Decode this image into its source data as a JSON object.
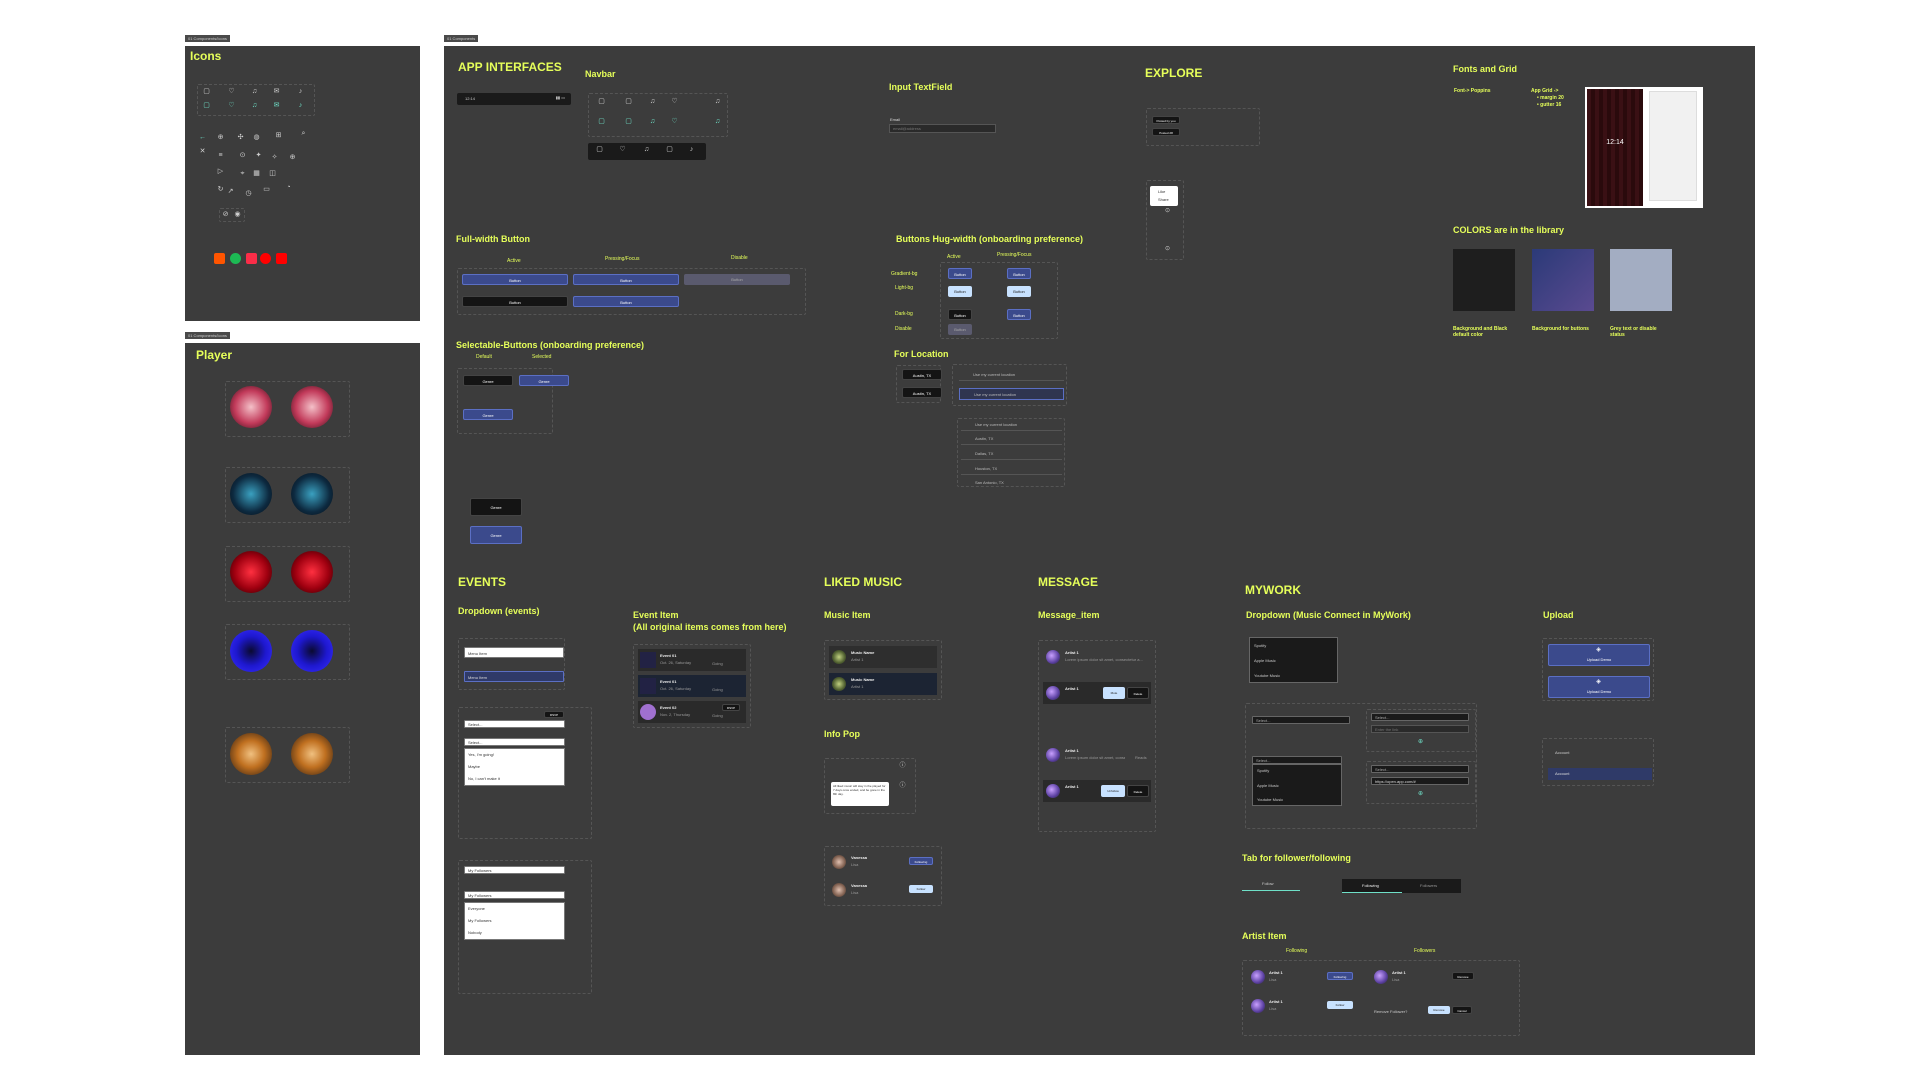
{
  "frame_tags": {
    "icons": "01 Components/Icons",
    "player": "01 Components/Icons",
    "main": "01 Components"
  },
  "icons_title": "Icons",
  "player_title": "Player",
  "app_interfaces": {
    "title": "APP INTERFACES",
    "status_time": "12:14",
    "navbar_title": "Navbar",
    "input_title": "Input TextField",
    "input_label": "Email",
    "input_placeholder": "email@address",
    "full_width_title": "Full-width Button",
    "states": [
      "Active",
      "Pressing/Focus",
      "Disable"
    ],
    "button_label": "Button",
    "selectable_title": "Selectable-Buttons (onboarding preference)",
    "selectable_states": [
      "Default",
      "Selected"
    ],
    "genre_label": "Genre",
    "hug_title": "Buttons Hug-width (onboarding preference)",
    "hug_states": [
      "Active",
      "Pressing/Focus"
    ],
    "hug_rows": [
      "Gradient-bg",
      "Light-bg",
      "Dark-bg",
      "Disable"
    ],
    "location_title": "For Location",
    "location_chip": "Austin, TX",
    "use_current": "Use my current location",
    "locations": [
      "Use my current location",
      "Austin, TX",
      "Dallas, TX",
      "Houston, TX",
      "San Antonio, TX"
    ]
  },
  "explore": {
    "title": "EXPLORE",
    "chips": [
      "Posted by you",
      "Posted 28"
    ],
    "menu": [
      "Like",
      "Share"
    ]
  },
  "fonts": {
    "title": "Fonts and Grid",
    "font_line": "Font-> Poppins",
    "grid_line1": "App Grid ->",
    "grid_line2": "• margin 20",
    "grid_line3": "• gutter 16",
    "clock": "12:14"
  },
  "colors": {
    "title": "COLORS are in the library",
    "swatches": [
      {
        "color": "#1e1e1e",
        "label": "Background and Black default color"
      },
      {
        "color": "#3f4f8a",
        "label": "Background for buttons"
      },
      {
        "color": "#a3adc2",
        "label": "Grey text or disable status"
      }
    ]
  },
  "events": {
    "title": "EVENTS",
    "dropdown_title": "Dropdown (events)",
    "menu_item": "Menu Item",
    "rsvp": "RSVP",
    "select": "Select...",
    "options": [
      "Yes, I'm going!",
      "Maybe",
      "No, I can't make it"
    ],
    "followers_select": "My Followers",
    "followers_options": [
      "Everyone",
      "My Followers",
      "Nobody"
    ],
    "event_item_title": "Event Item",
    "event_item_sub": "(All original items comes from here)",
    "event_items": [
      {
        "name": "Event 01",
        "date": "Oct. 26, Saturday"
      },
      {
        "name": "Event 01",
        "date": "Oct. 26, Saturday"
      },
      {
        "name": "Event 02",
        "date": "Nov. 2, Thursday"
      }
    ],
    "going": "Going"
  },
  "liked": {
    "title": "LIKED MUSIC",
    "music_item_title": "Music Item",
    "items": [
      {
        "name": "Music Name",
        "artist": "Artist 1"
      },
      {
        "name": "Music Name",
        "artist": "Artist 1"
      }
    ],
    "info_pop_title": "Info Pop",
    "info_pop_text": "All liked music will stay in the played for 7 days once ended, and be gone in the 8th day.",
    "follow_people": [
      {
        "name": "Vanessa",
        "sub": "Lisa",
        "action": "Following"
      },
      {
        "name": "Vanessa",
        "sub": "Lisa",
        "action": "Follow"
      }
    ]
  },
  "message": {
    "title": "MESSAGE",
    "item_title": "Message_item",
    "artist": "Artist 1",
    "preview": "Lorem ipsum dolor sit amet, consectetur a...",
    "mute": "Mute",
    "delete": "Delete",
    "unfollow": "Unfollow",
    "time": "Reads"
  },
  "mywork": {
    "title": "MYWORK",
    "dropdown_title": "Dropdown (Music Connect in MyWork)",
    "services": [
      "Spotify",
      "Apple Music",
      "Youtube Music"
    ],
    "select": "Select...",
    "link_placeholder": "Enter the link",
    "link_value": "https://open.app.com/#",
    "tab_title": "Tab for follower/following",
    "tabs": [
      "Following",
      "Followers"
    ],
    "tab_single": "Follow",
    "artist_item_title": "Artist Item",
    "artist_cols": [
      "Following",
      "Followers"
    ],
    "artist": "Artist 1",
    "artist_sub": "Lisa",
    "following_btn": "Following",
    "follow_btn": "Follow",
    "remove_btn": "Remove",
    "remove_q": "Remove Follower?",
    "cancel_btn": "Cancel"
  },
  "upload": {
    "title": "Upload",
    "button": "Upload Demo",
    "account": "Account"
  }
}
